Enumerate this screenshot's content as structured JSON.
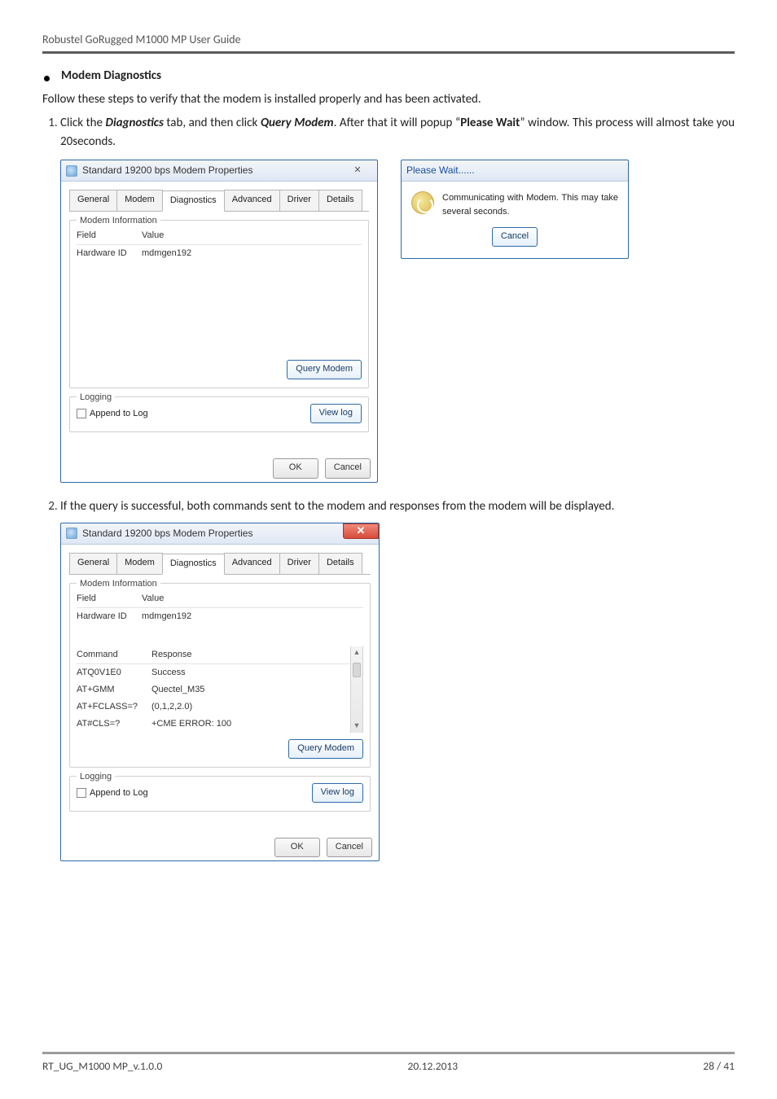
{
  "header": {
    "guide_title": "Robustel GoRugged M1000 MP User Guide"
  },
  "section": {
    "title": "Modem Diagnostics"
  },
  "intro": "Follow these steps to verify that the modem is installed properly and has been activated.",
  "step1": {
    "pre": "Click the ",
    "diag": "Diagnostics",
    "mid1": " tab, and then click ",
    "query": "Query Modem",
    "mid2": ". After that it will popup “",
    "pw": "Please Wait",
    "post": "” window. This process will almost take you 20seconds."
  },
  "step2": "If the query is successful, both commands sent to the modem and responses from the modem will be displayed.",
  "win": {
    "title": "Standard 19200 bps Modem Properties",
    "tabs": {
      "general": "General",
      "modem": "Modem",
      "diag": "Diagnostics",
      "adv": "Advanced",
      "driver": "Driver",
      "details": "Details"
    },
    "modem_info_legend": "Modem Information",
    "field": "Field",
    "value": "Value",
    "hwid_label": "Hardware ID",
    "hwid_value": "mdmgen192",
    "cmd_h": "Command",
    "resp_h": "Response",
    "r1c": "ATQ0V1E0",
    "r1r": "Success",
    "r2c": "AT+GMM",
    "r2r": "Quectel_M35",
    "r3c": "AT+FCLASS=?",
    "r3r": "(0,1,2,2.0)",
    "r4c": "AT#CLS=?",
    "r4r": "+CME ERROR: 100",
    "query_btn": "Query Modem",
    "logging_legend": "Logging",
    "append": "Append to Log",
    "viewlog": "View log",
    "ok": "OK",
    "cancel": "Cancel"
  },
  "pw": {
    "title": "Please Wait......",
    "msg": "Communicating with Modem. This may take several seconds.",
    "cancel": "Cancel"
  },
  "footer": {
    "left": "RT_UG_M1000 MP_v.1.0.0",
    "center": "20.12.2013",
    "right": "28 / 41"
  }
}
